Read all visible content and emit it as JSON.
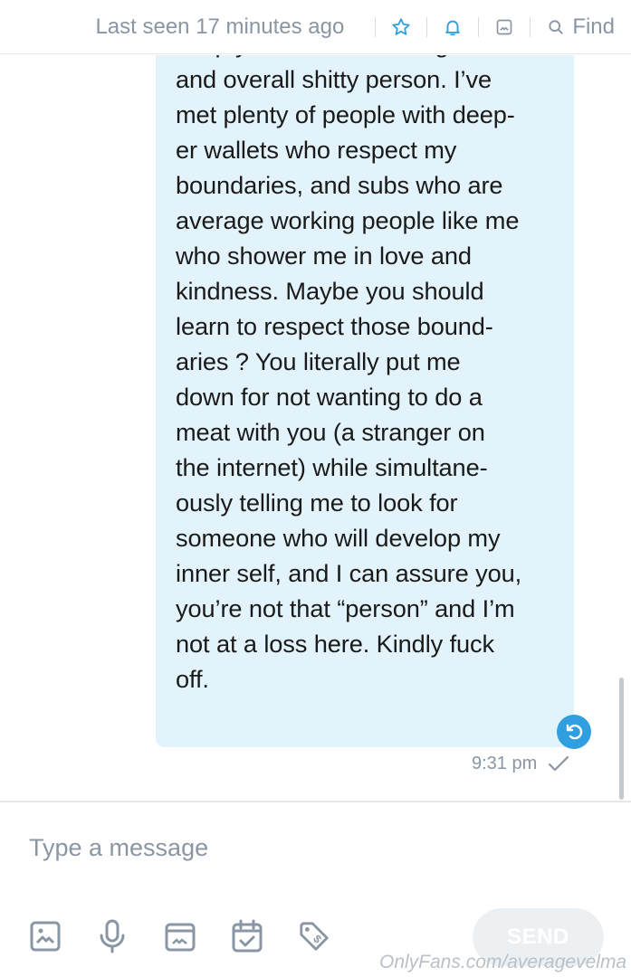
{
  "header": {
    "last_seen": "Last seen 17 minutes ago",
    "find_label": "Find",
    "icons": [
      "star-icon",
      "bell-icon",
      "gallery-icon",
      "search-icon"
    ]
  },
  "message": {
    "text": "keep you from also being bum\nand overall shitty person. I’ve\nmet plenty of people with deep-\ner wallets who respect my\nboundaries, and subs who are\naverage working people like me\nwho shower me in love and\nkindness. Maybe you should\nlearn to respect those bound-\naries ? You literally put me\ndown for not wanting to do a\nmeat with you (a stranger on\nthe internet) while simultane-\nously telling me to look for\nsomeone who will develop my\ninner self, and I can assure you,\nyou’re not that “person” and I’m\nnot at a loss here. Kindly fuck\noff.",
    "time": "9:31 pm",
    "status": "sent",
    "accent_color": "#2f9fe0",
    "bubble_color": "#e3f3fb"
  },
  "composer": {
    "placeholder": "Type a message",
    "value": "",
    "send_label": "SEND",
    "tools": [
      "image-icon",
      "microphone-icon",
      "vault-icon",
      "calendar-icon",
      "price-tag-icon"
    ]
  },
  "watermark": "OnlyFans.com/averagevelma"
}
